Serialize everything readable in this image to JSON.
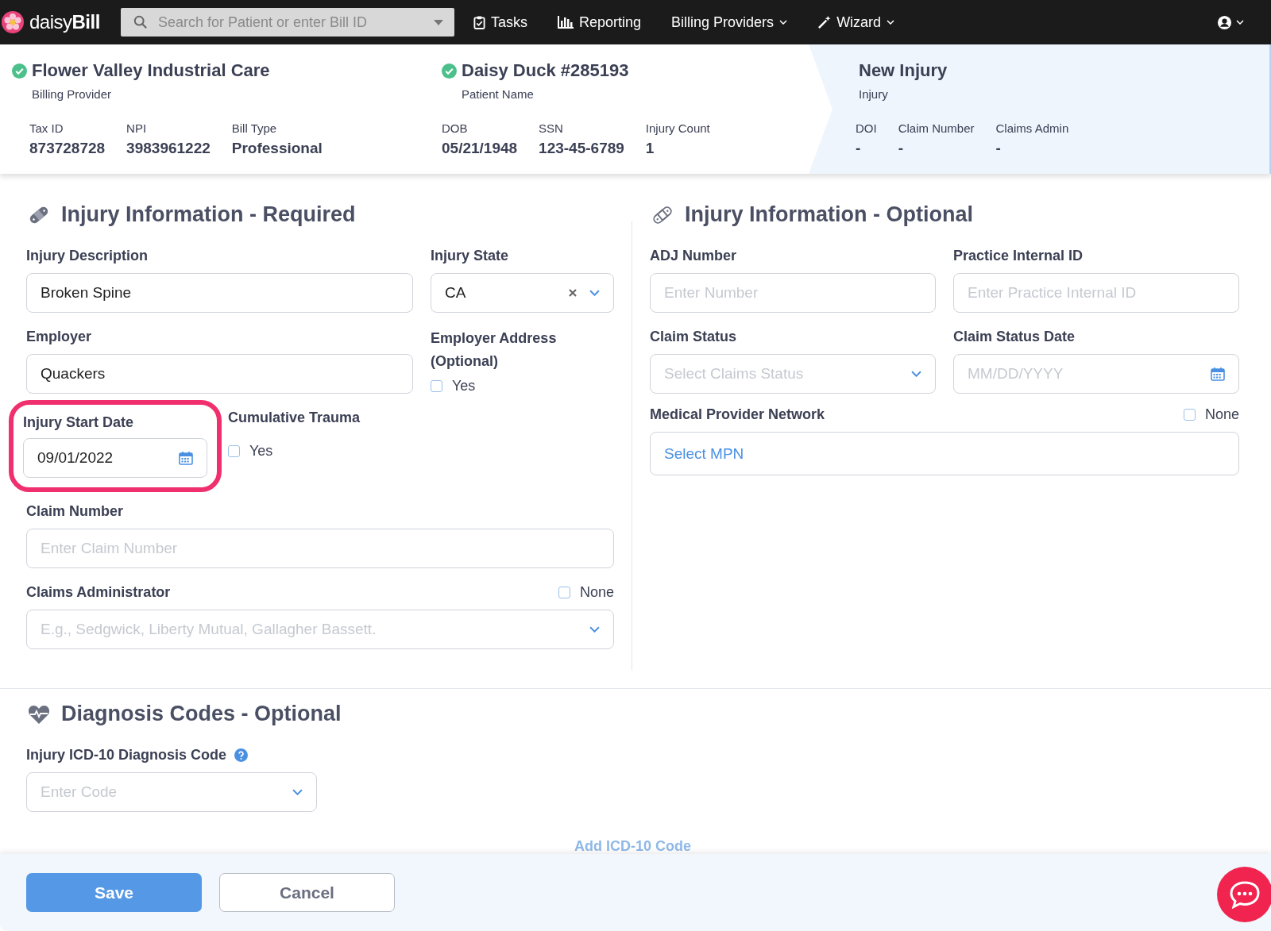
{
  "nav": {
    "brand": "daisy**Bill**",
    "search": {
      "placeholder": "Search for Patient or enter Bill ID"
    },
    "items": [
      {
        "label": "Tasks",
        "kind": "tasks"
      },
      {
        "label": "Reporting",
        "kind": "reporting"
      },
      {
        "label": "Billing Providers",
        "kind": "menu"
      },
      {
        "label": "Wizard",
        "kind": "wizard"
      }
    ]
  },
  "steps": [
    {
      "title": "Flower Valley Industrial Care",
      "subtitle": "Billing Provider",
      "done": true,
      "selected": false,
      "fields": [
        {
          "label": "Tax ID",
          "value": "873728728"
        },
        {
          "label": "NPI",
          "value": "3983961222"
        },
        {
          "label": "Bill Type",
          "value": "Professional"
        }
      ]
    },
    {
      "title": "Daisy Duck #285193",
      "subtitle": "Patient Name",
      "done": true,
      "selected": false,
      "fields": [
        {
          "label": "DOB",
          "value": "05/21/1948"
        },
        {
          "label": "SSN",
          "value": "123-45-6789"
        },
        {
          "label": "Injury Count",
          "value": "1"
        }
      ]
    },
    {
      "title": "New Injury",
      "subtitle": "Injury",
      "done": false,
      "selected": true,
      "fields": [
        {
          "label": "DOI",
          "value": "-"
        },
        {
          "label": "Claim Number",
          "value": "-"
        },
        {
          "label": "Claims Admin",
          "value": "-"
        }
      ]
    }
  ],
  "required": {
    "title": "Injury Information - Required",
    "injury_description": {
      "label": "Injury Description",
      "value": "Broken Spine"
    },
    "injury_state": {
      "label": "Injury State",
      "value": "CA"
    },
    "employer": {
      "label": "Employer",
      "value": "Quackers"
    },
    "employer_address": {
      "label": "Employer Address (Optional)",
      "option": "Yes",
      "checked": false
    },
    "injury_start_date": {
      "label": "Injury Start Date",
      "value": "09/01/2022",
      "highlighted": true
    },
    "cumulative_trauma": {
      "label": "Cumulative Trauma",
      "option": "Yes",
      "checked": false
    },
    "claim_number": {
      "label": "Claim Number",
      "placeholder": "Enter Claim Number"
    },
    "claims_administrator": {
      "label": "Claims Administrator",
      "none_label": "None",
      "none_checked": false,
      "placeholder": "E.g., Sedgwick, Liberty Mutual, Gallagher Bassett."
    }
  },
  "optional": {
    "title": "Injury Information - Optional",
    "adj_number": {
      "label": "ADJ Number",
      "placeholder": "Enter Number"
    },
    "practice_internal_id": {
      "label": "Practice Internal ID",
      "placeholder": "Enter Practice Internal ID"
    },
    "claim_status": {
      "label": "Claim Status",
      "placeholder": "Select Claims Status"
    },
    "claim_status_date": {
      "label": "Claim Status Date",
      "placeholder": "MM/DD/YYYY"
    },
    "mpn": {
      "label": "Medical Provider Network",
      "none_label": "None",
      "none_checked": false,
      "value": "Select MPN"
    }
  },
  "diagnosis": {
    "title": "Diagnosis Codes - Optional",
    "code": {
      "label": "Injury ICD-10 Diagnosis Code",
      "placeholder": "Enter Code"
    },
    "add_link": "Add ICD-10 Code"
  },
  "footer": {
    "buttons": [
      {
        "label": "Save",
        "kind": "primary"
      },
      {
        "label": "Cancel",
        "kind": "secondary"
      }
    ]
  }
}
